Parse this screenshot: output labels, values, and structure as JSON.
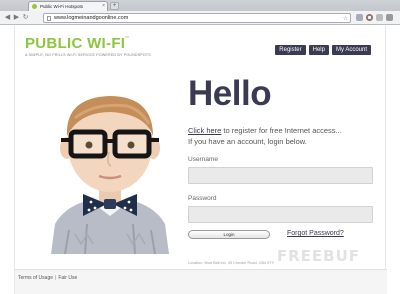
{
  "browser": {
    "tab_title": "Public Wi-Fi Hotspots",
    "tab_close": "×",
    "new_tab": "+",
    "url": "www.logmeinandgoonline.com",
    "star": "☆",
    "icons": [
      "back-icon",
      "forward-icon",
      "reload-icon",
      "page-icon",
      "star-icon",
      "favicon-icon"
    ]
  },
  "header": {
    "logo": "PUBLIC WI-FI",
    "logo_tm": "™",
    "tagline": "A SIMPLE, NO FRILLS WI-FI SERVICE POWERED BY POUNDSPOTS",
    "nav": [
      "Register",
      "Help",
      "My Account"
    ]
  },
  "main": {
    "heading": "Hello",
    "click_here": "Click here",
    "intro_rest": " to register for free Internet access...",
    "intro_line2": "If you have an account, login below.",
    "username_label": "Username",
    "username_value": "",
    "password_label": "Password",
    "password_value": "",
    "login_label": "Login",
    "forgot_label": "Forgot Password?",
    "location": "Location: Blue Ball Inn, 45 Chester Road, CB4 5TY"
  },
  "footer": {
    "terms": "Terms of Usage",
    "separator": "|",
    "fair_use": "Fair Use",
    "watermark": "FREEBUF"
  },
  "colors": {
    "brand_green": "#8cc63f",
    "navy": "#3a3a52",
    "input_bg": "#eaeaea"
  }
}
